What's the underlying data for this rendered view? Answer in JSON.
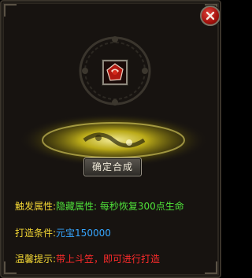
{
  "colors": {
    "panel_bg": "#171310",
    "label_yellow": "#f2d634",
    "value_green": "#4fe13a",
    "value_blue": "#36a6ff",
    "tip_red": "#ff2b2b",
    "glow_yellow": "#d7c51a"
  },
  "item": {
    "icon": "red-gem-icon"
  },
  "button": {
    "confirm_label": "确定合成"
  },
  "info": {
    "trigger_label": "触发属性:",
    "trigger_value": "隐藏属性: 每秒恢复300点生命",
    "cost_label": "打造条件:",
    "cost_value": "元宝150000",
    "tip_label": "温馨提示:",
    "tip_value": "带上斗笠，即可进行打造"
  }
}
